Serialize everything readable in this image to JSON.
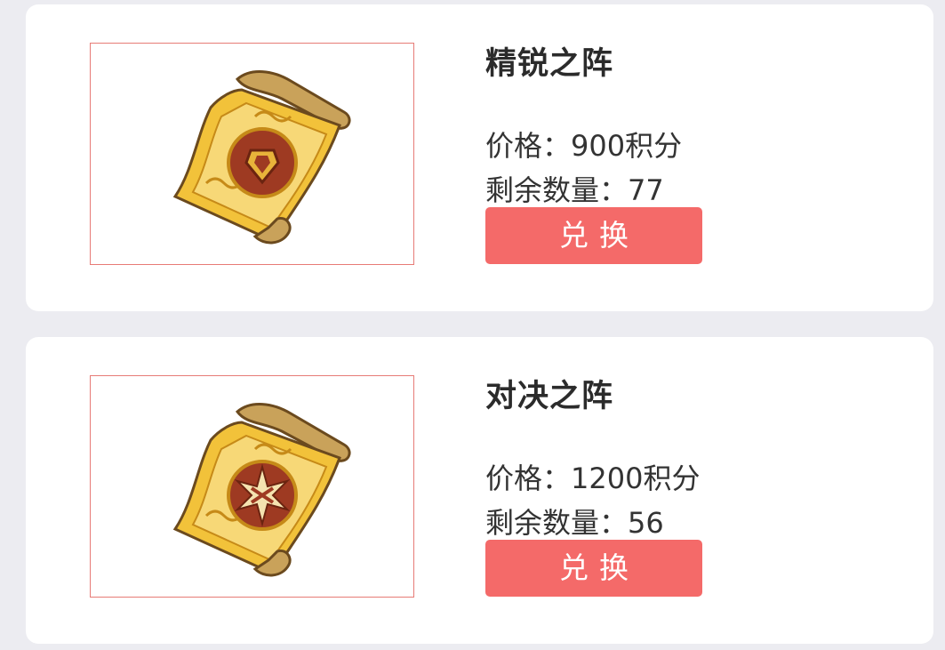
{
  "items": [
    {
      "name": "精锐之阵",
      "price_label": "价格：",
      "price_value": "900积分",
      "stock_label": "剩余数量：",
      "stock_value": "77",
      "button_label": "兑换",
      "emblem_icon": "shield-emblem-icon"
    },
    {
      "name": "对决之阵",
      "price_label": "价格：",
      "price_value": "1200积分",
      "stock_label": "剩余数量：",
      "stock_value": "56",
      "button_label": "兑换",
      "emblem_icon": "clash-emblem-icon"
    }
  ],
  "colors": {
    "page_background": "#ececf1",
    "card_background": "#ffffff",
    "button": "#f46a69",
    "thumb_border": "#e77b76",
    "scroll_gold": "#f2c23a",
    "emblem_red": "#9e3a22"
  }
}
